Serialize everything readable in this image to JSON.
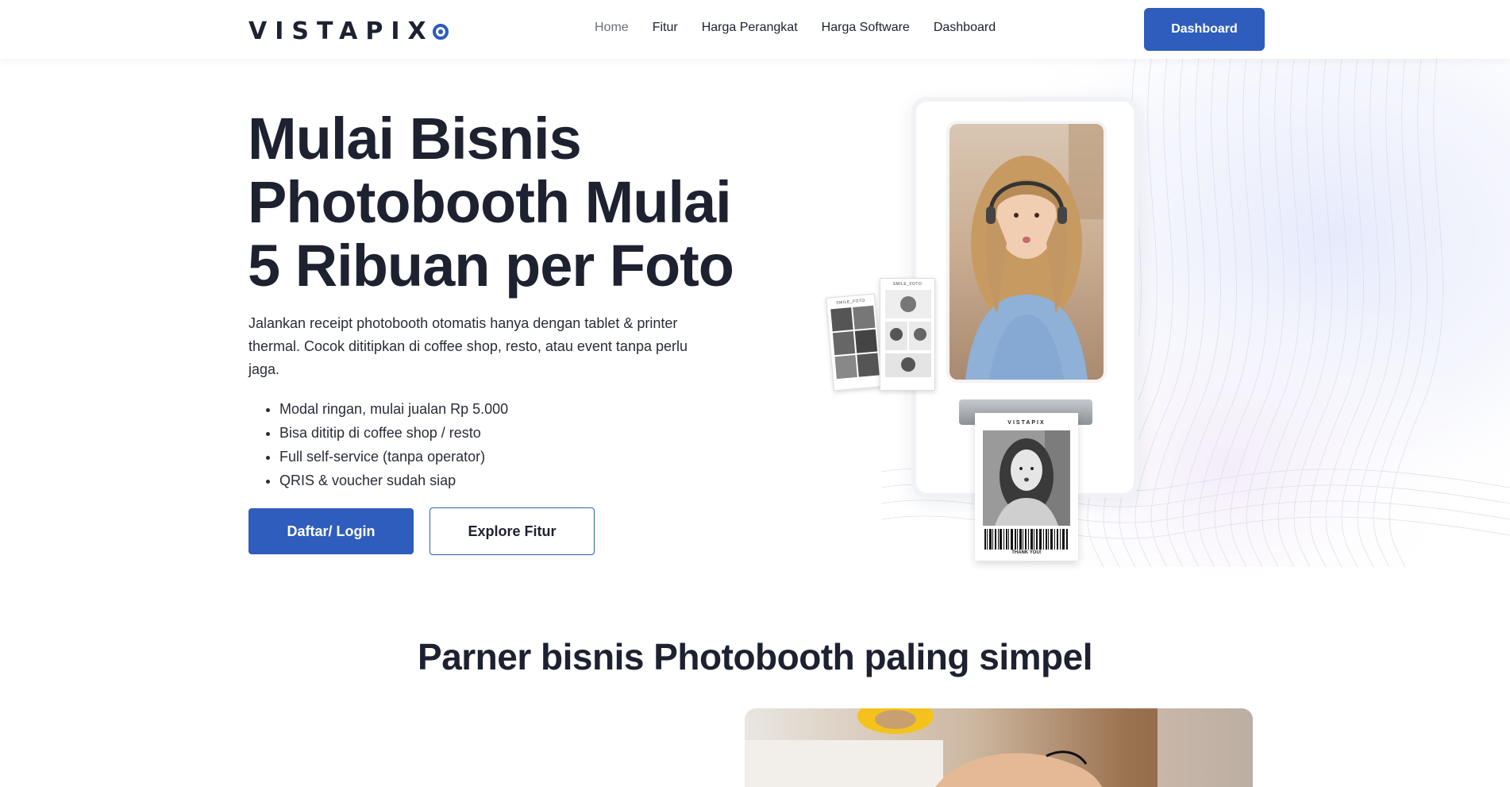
{
  "header": {
    "logo_text": "VISTAPIX",
    "nav": [
      "Home",
      "Fitur",
      "Harga Perangkat",
      "Harga Software",
      "Dashboard"
    ],
    "active_nav": "Home",
    "cta_label": "Dashboard"
  },
  "hero": {
    "title": "Mulai Bisnis Photobooth Mulai 5 Ribuan per Foto",
    "description": "Jalankan receipt photobooth otomatis hanya dengan tablet & printer thermal. Cocok dititipkan di coffee shop, resto, atau event tanpa perlu jaga.",
    "bullets": [
      "Modal ringan, mulai jualan Rp 5.000",
      "Bisa dititip di coffee shop / resto",
      "Full self-service (tanpa operator)",
      "QRIS & voucher sudah siap"
    ],
    "primary_button": "Daftar/ Login",
    "secondary_button": "Explore Fitur"
  },
  "illustration": {
    "receipt_brand": "VISTAPIX",
    "receipt_footer": "THANK YOU!",
    "strip_label": "SMILE_FOTO"
  },
  "section": {
    "title": "Parner bisnis Photobooth paling simpel"
  },
  "colors": {
    "primary": "#2f5dbd",
    "text": "#1d2130",
    "nav_active": "#6b6f7c"
  }
}
